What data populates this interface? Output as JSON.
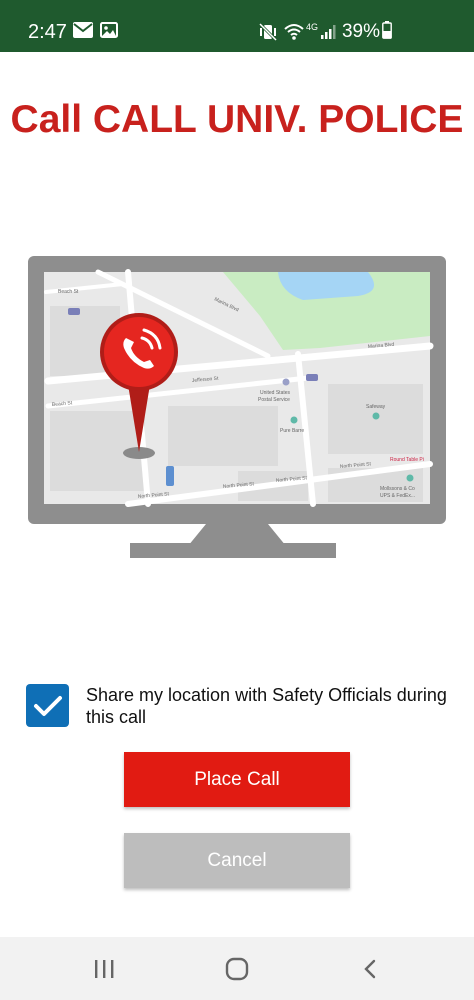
{
  "status_bar": {
    "time": "2:47",
    "network_type": "4G",
    "battery_percent": "39%",
    "left_icons": [
      "mail-icon",
      "image-icon"
    ],
    "right_icons": [
      "vibrate-mute-icon",
      "wifi-icon",
      "signal-icon",
      "battery-icon"
    ]
  },
  "header": {
    "title": "Call CALL UNIV. POLICE"
  },
  "illustration": {
    "icon": "phone-location-pin-icon",
    "map_labels": {
      "marina_blvd_top": "Marina Blvd",
      "marina_blvd_right": "Marina Blvd",
      "beach_st_left": "Beach St",
      "beach_st_mid": "Beach St",
      "jefferson_st": "Jefferson St",
      "post_office_1": "United States",
      "post_office_2": "Postal Service",
      "pure_barre": "Pure Barre",
      "safeway": "Safeway",
      "round_table": "Round Table Pi",
      "north_point_1": "North Point St",
      "north_point_2": "North Point St",
      "north_point_3": "North Point St",
      "north_point_4": "North Point St",
      "mollssons_1": "Mollssons & Co",
      "mollssons_2": "UPS & FedEx..."
    }
  },
  "location_share": {
    "checked": true,
    "label": "Share my location with Safety Officials during this call"
  },
  "buttons": {
    "place_call": "Place Call",
    "cancel": "Cancel"
  },
  "colors": {
    "status_bar": "#1f5a2e",
    "title": "#c8211d",
    "primary_button": "#e11b12",
    "secondary_button": "#bdbdbd",
    "checkbox": "#0f6fb6",
    "monitor": "#8e8e8e"
  },
  "nav_bar": {
    "icons": [
      "recent-apps-icon",
      "home-icon",
      "back-icon"
    ]
  }
}
